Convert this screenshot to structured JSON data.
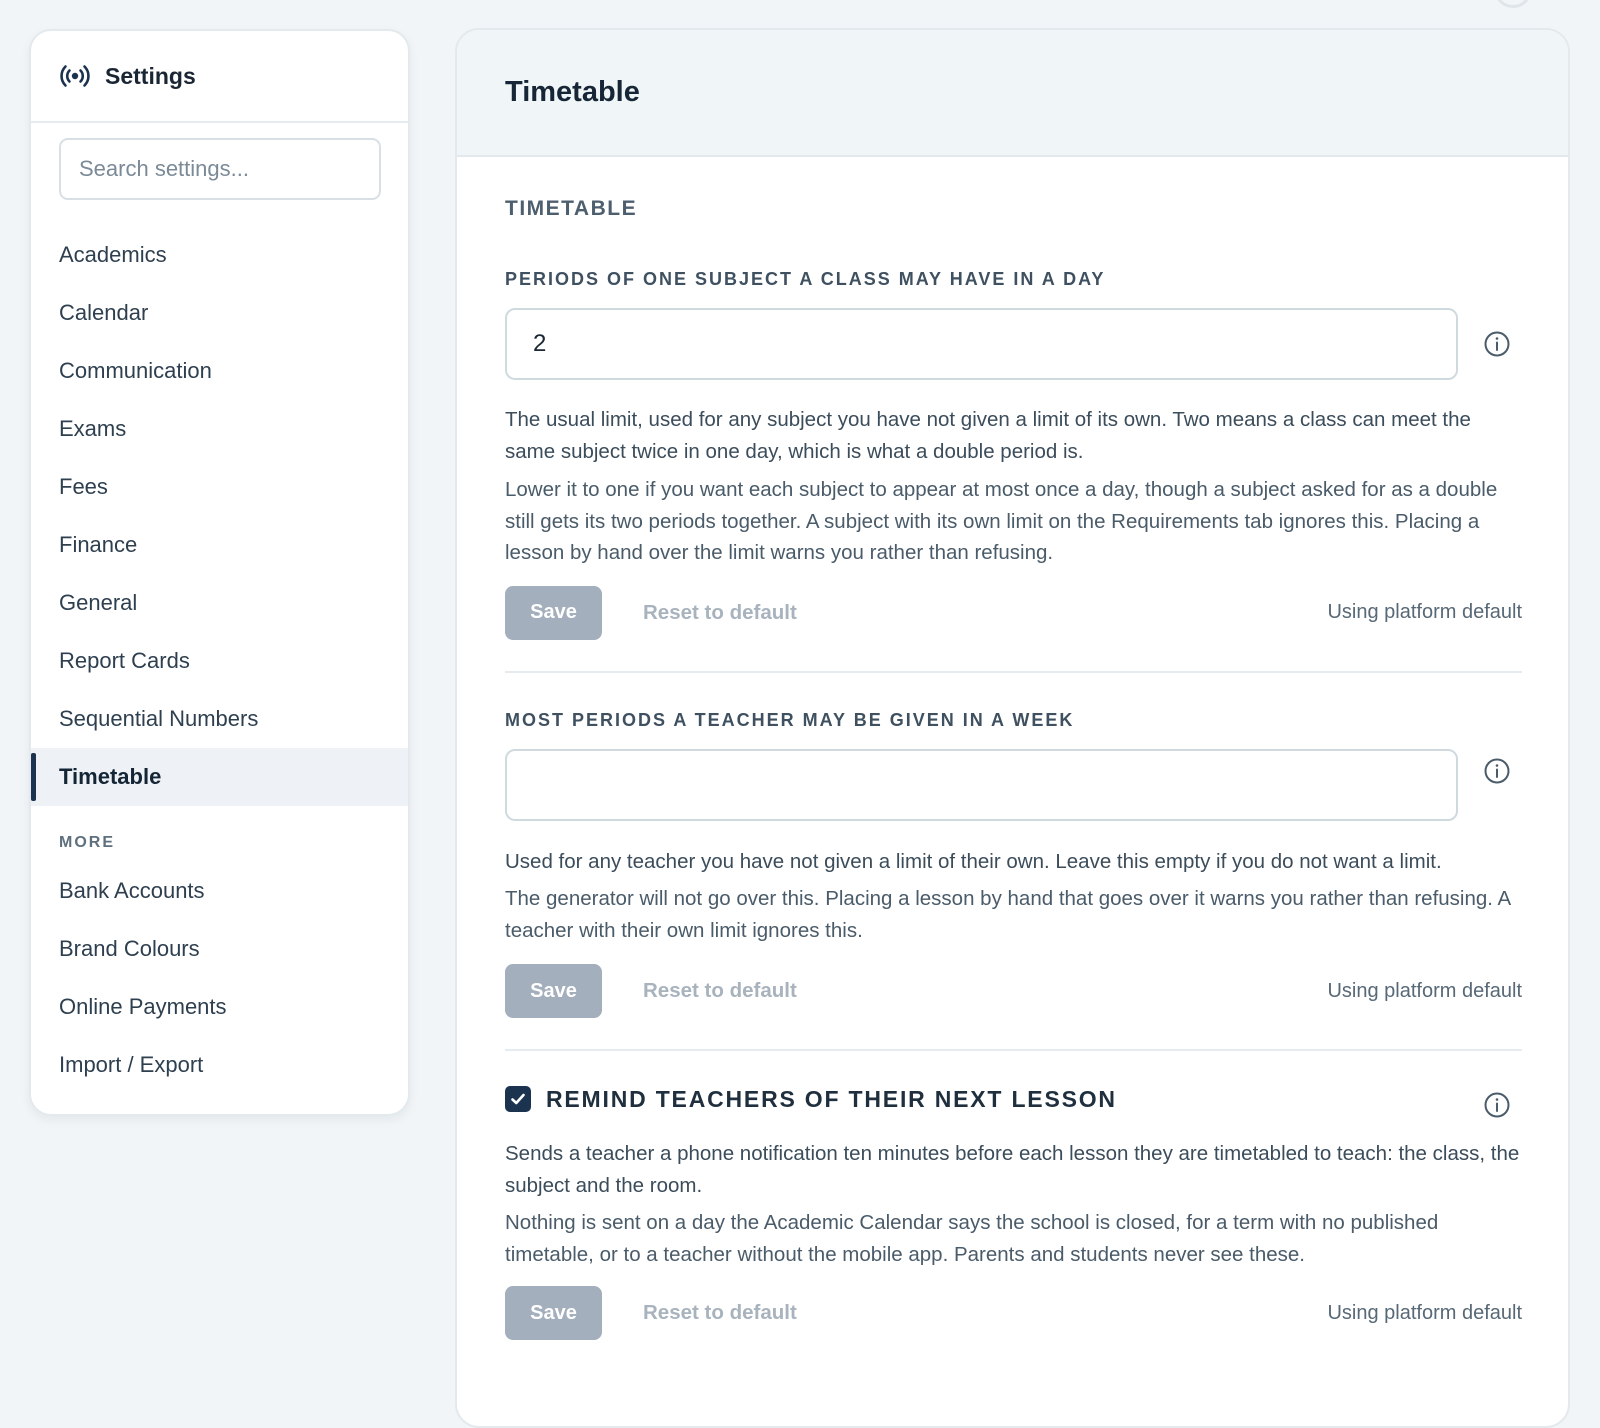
{
  "sidebar": {
    "title": "Settings",
    "title_icon": "settings-broadcast-icon",
    "search_placeholder": "Search settings...",
    "items": [
      {
        "label": "Academics"
      },
      {
        "label": "Calendar"
      },
      {
        "label": "Communication"
      },
      {
        "label": "Exams"
      },
      {
        "label": "Fees"
      },
      {
        "label": "Finance"
      },
      {
        "label": "General"
      },
      {
        "label": "Report Cards"
      },
      {
        "label": "Sequential Numbers"
      },
      {
        "label": "Timetable",
        "active": true
      }
    ],
    "more_heading": "MORE",
    "more_items": [
      {
        "label": "Bank Accounts"
      },
      {
        "label": "Brand Colours"
      },
      {
        "label": "Online Payments"
      },
      {
        "label": "Import / Export"
      }
    ]
  },
  "main": {
    "title": "Timetable",
    "section_heading": "TIMETABLE",
    "fields": [
      {
        "label": "PERIODS OF ONE SUBJECT A CLASS MAY HAVE IN A DAY",
        "value": "2",
        "desc1": "The usual limit, used for any subject you have not given a limit of its own. Two means a class can meet the same subject twice in one day, which is what a double period is.",
        "desc2": "Lower it to one if you want each subject to appear at most once a day, though a subject asked for as a double still gets its two periods together. A subject with its own limit on the Requirements tab ignores this. Placing a lesson by hand over the limit warns you rather than refusing.",
        "save_label": "Save",
        "reset_label": "Reset to default",
        "status": "Using platform default"
      },
      {
        "label": "MOST PERIODS A TEACHER MAY BE GIVEN IN A WEEK",
        "value": "",
        "desc1": "Used for any teacher you have not given a limit of their own. Leave this empty if you do not want a limit.",
        "desc2": "The generator will not go over this. Placing a lesson by hand that goes over it warns you rather than refusing. A teacher with their own limit ignores this.",
        "save_label": "Save",
        "reset_label": "Reset to default",
        "status": "Using platform default"
      },
      {
        "label": "REMIND TEACHERS OF THEIR NEXT LESSON",
        "checked": true,
        "desc1": "Sends a teacher a phone notification ten minutes before each lesson they are timetabled to teach: the class, the subject and the room.",
        "desc2": "Nothing is sent on a day the Academic Calendar says the school is closed, for a term with no published timetable, or to a teacher without the mobile app. Parents and students never see these.",
        "save_label": "Save",
        "reset_label": "Reset to default",
        "status": "Using platform default"
      }
    ]
  },
  "colors": {
    "accent": "#1c3350",
    "save_disabled": "#a3afbc",
    "page_bg": "#f1f5f7"
  }
}
